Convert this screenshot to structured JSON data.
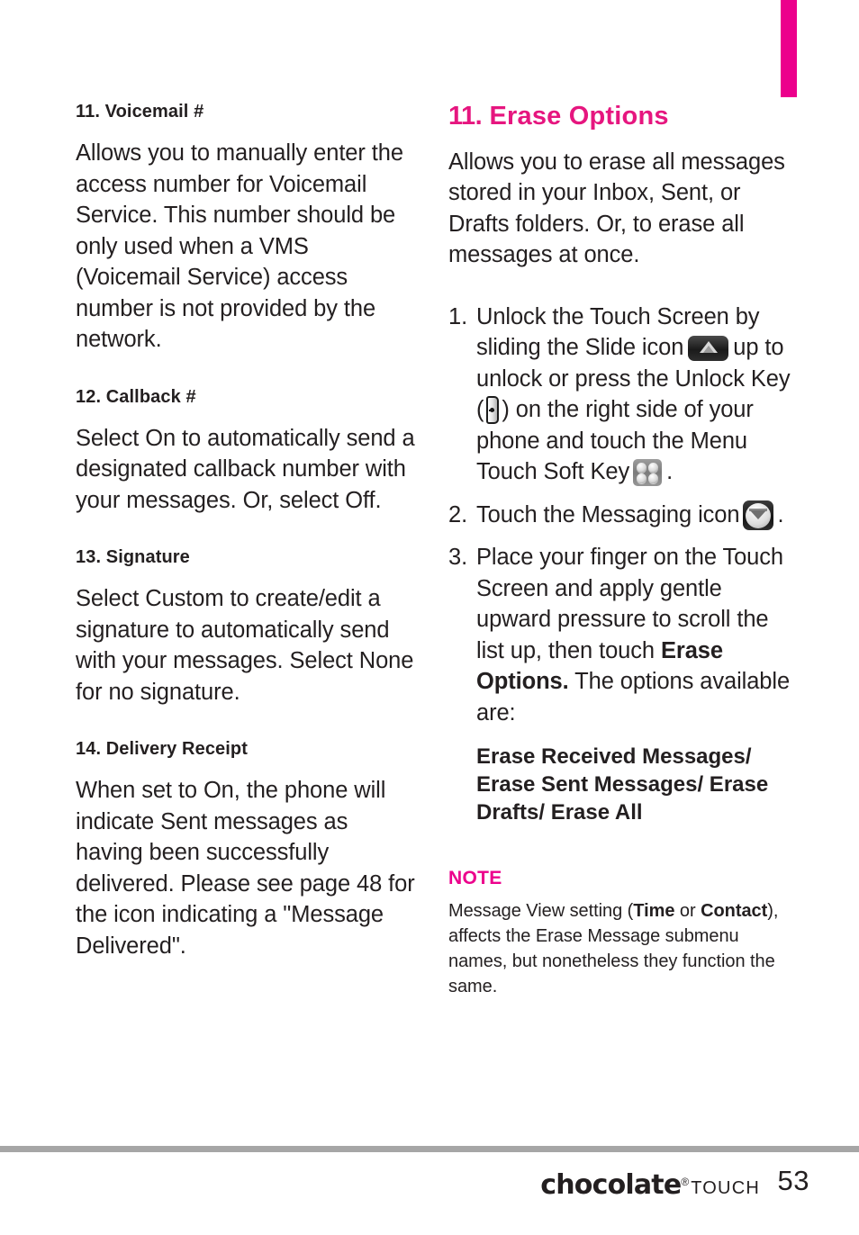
{
  "page": {
    "number": "53",
    "brand_word": "chocolate",
    "brand_reg": "®",
    "brand_sub": "TOUCH",
    "tab_color": "#ec008c",
    "accent_color": "#e6167f",
    "rule_color": "#a6a6a6"
  },
  "left_column": {
    "sections": [
      {
        "heading": "11. Voicemail #",
        "body": "Allows you to manually enter the access number for Voicemail Service. This number should be only used when a VMS (Voicemail Service) access number is not provided by the network."
      },
      {
        "heading": "12. Callback #",
        "body": "Select On to automatically send a designated callback number with your messages. Or, select Off."
      },
      {
        "heading": "13. Signature",
        "body": "Select Custom to create/edit a signature to automatically send with your messages. Select None for no signature."
      },
      {
        "heading": "14. Delivery Receipt",
        "body": "When set to On, the phone will indicate Sent messages as having been successfully delivered. Please see page 48 for the icon indicating a \"Message Delivered\"."
      }
    ]
  },
  "right_column": {
    "heading_number": "11.",
    "heading_text": "Erase Options",
    "intro": "Allows you to erase all messages stored in your Inbox, Sent, or Drafts folders. Or, to erase all messages at once.",
    "steps": [
      {
        "marker": "1.",
        "part1": "Unlock the Touch Screen by sliding the Slide icon",
        "icon1": "slide-icon",
        "part2": "up to unlock or press the Unlock Key (",
        "icon2": "unlock-key-icon",
        "part3": ") on the right side of your phone and touch the Menu Touch Soft Key",
        "icon3": "menu-soft-key-icon",
        "part4": "."
      },
      {
        "marker": "2.",
        "part1": "Touch the Messaging icon",
        "icon1": "messaging-icon",
        "part2": "."
      },
      {
        "marker": "3.",
        "part1": "Place your finger on the Touch Screen and apply gentle upward pressure to scroll the list up, then touch",
        "bold": "Erase Options.",
        "part2": "The options available are:"
      }
    ],
    "options_list": "Erase Received Messages/ Erase Sent Messages/ Erase Drafts/ Erase All",
    "note": {
      "label": "NOTE",
      "text_1": "Message View setting (",
      "bold_1": "Time",
      "text_2": " or ",
      "bold_2": "Contact",
      "text_3": "), affects the Erase Message submenu names, but nonetheless they function the same."
    }
  }
}
